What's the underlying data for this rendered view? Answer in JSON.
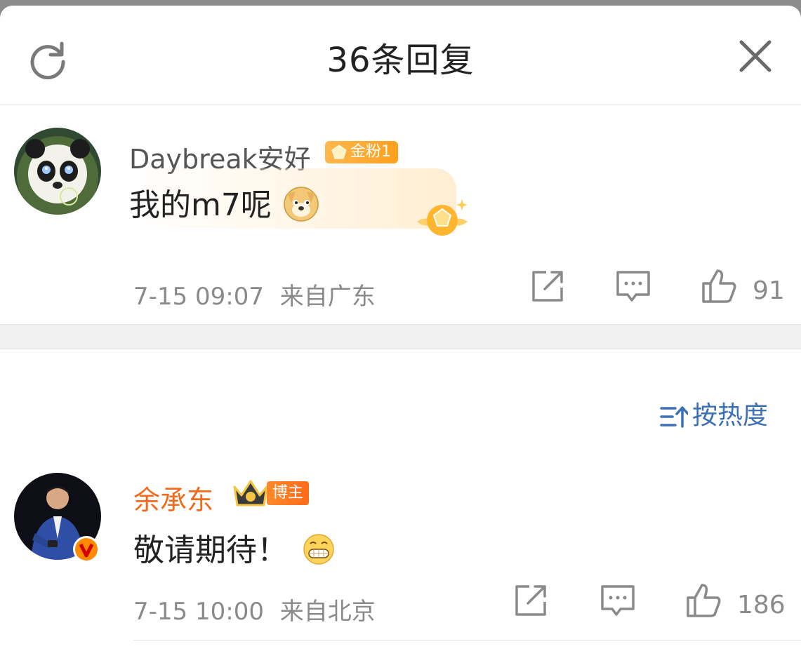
{
  "header": {
    "title": "36条回复",
    "refresh_icon": "refresh-icon",
    "close_icon": "close-icon"
  },
  "comments": [
    {
      "username": "Daybreak安好",
      "badge": "金粉1",
      "content": "我的m7呢",
      "emoji": "doge-emoji",
      "time": "7-15 09:07",
      "location": "来自广东",
      "likes": "91"
    },
    {
      "username": "余承东",
      "badge": "博主",
      "content": "敬请期待！",
      "emoji": "grin-emoji",
      "time": "7-15 10:00",
      "location": "来自北京",
      "likes": "186"
    }
  ],
  "sort": {
    "label": "按热度"
  },
  "colors": {
    "accent_blue": "#3b6fb6",
    "host_name_orange": "#f26b1d",
    "fan_badge": "#ffaa33"
  }
}
